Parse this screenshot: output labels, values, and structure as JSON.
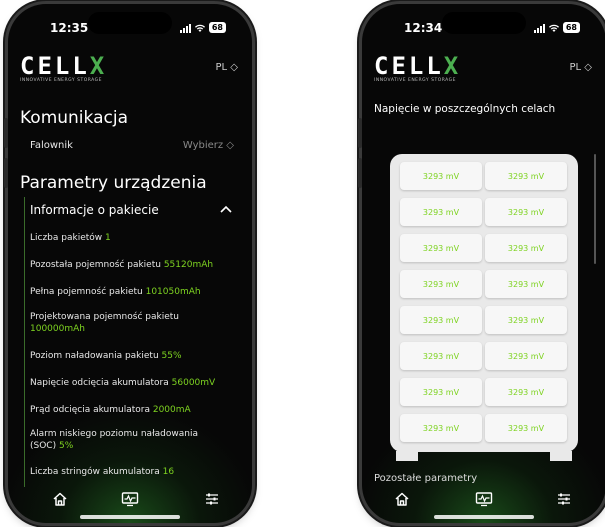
{
  "left_screen": {
    "status": {
      "time": "12:35",
      "battery": "68"
    },
    "brand": {
      "name": "CELL",
      "name_accent": "X",
      "tagline": "INNOVATIVE ENERGY STORAGE"
    },
    "language": "PL ◇",
    "communication": {
      "title": "Komunikacja",
      "inverter_label": "Falownik",
      "inverter_value": "Wybierz ◇"
    },
    "parameters": {
      "title": "Parametry urządzenia",
      "pack_info_label": "Informacje o pakiecie",
      "rows": [
        {
          "label": "Liczba pakietów ",
          "value": "1"
        },
        {
          "label": "Pozostała pojemność pakietu ",
          "value": "55120mAh"
        },
        {
          "label": "Pełna pojemność pakietu ",
          "value": "101050mAh"
        },
        {
          "label": "Projektowana pojemność pakietu ",
          "value": "100000mAh"
        },
        {
          "label": "Poziom naładowania pakietu ",
          "value": "55%"
        },
        {
          "label": "Napięcie odcięcia akumulatora ",
          "value": "56000mV"
        },
        {
          "label": "Prąd odcięcia akumulatora ",
          "value": "2000mA"
        },
        {
          "label": "Alarm niskiego poziomu naładowania (SOC) ",
          "value": "5%"
        },
        {
          "label": "Liczba stringów akumulatora ",
          "value": "16"
        }
      ]
    }
  },
  "right_screen": {
    "status": {
      "time": "12:34",
      "battery": "68"
    },
    "brand": {
      "name": "CELL",
      "name_accent": "X",
      "tagline": "INNOVATIVE ENERGY STORAGE"
    },
    "language": "PL ◇",
    "cells_title": "Napięcie w poszczególnych celach",
    "cells": [
      "3293 mV",
      "3293 mV",
      "3293 mV",
      "3293 mV",
      "3293 mV",
      "3293 mV",
      "3293 mV",
      "3293 mV",
      "3293 mV",
      "3293 mV",
      "3293 mV",
      "3293 mV",
      "3293 mV",
      "3293 mV",
      "3293 mV",
      "3293 mV"
    ],
    "other_params_title": "Pozostałe parametry"
  },
  "nav": {
    "icons": [
      "home-icon",
      "monitor-icon",
      "settings-sliders-icon"
    ]
  },
  "colors": {
    "accent": "#7ed321",
    "background": "#070707",
    "cell_bg": "#f7f7f7"
  }
}
